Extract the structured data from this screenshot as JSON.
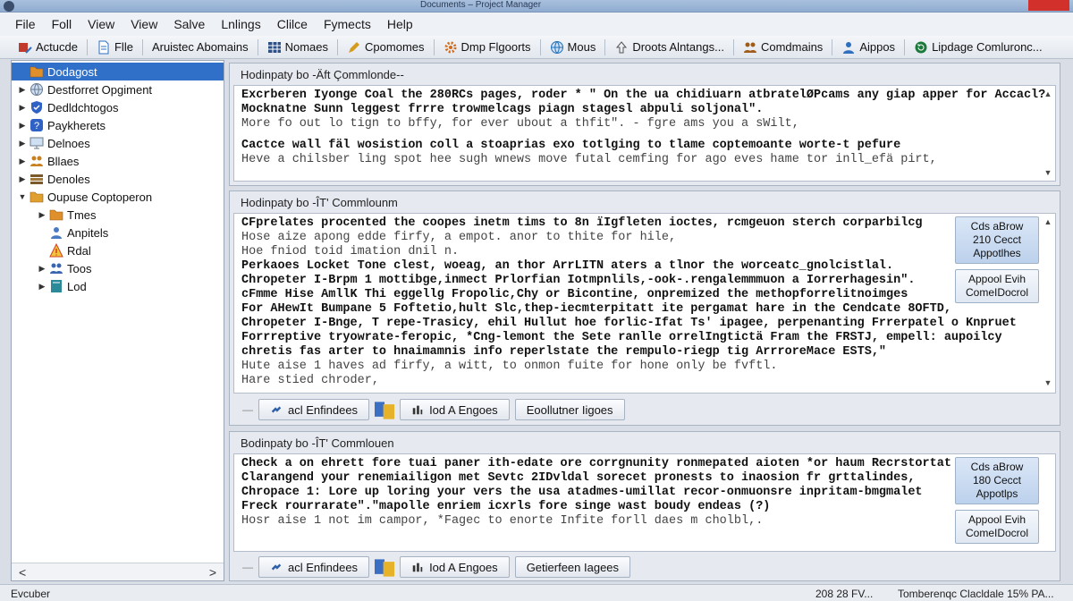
{
  "window": {
    "title": "Documents – Project Manager"
  },
  "menu": [
    "File",
    "Foll",
    "View",
    "View",
    "Salve",
    "Lnlings",
    "Clilce",
    "Fymects",
    "Help"
  ],
  "toolbar": [
    {
      "label": "Actucde",
      "icon": "tools-icon",
      "color": "#c0392b"
    },
    {
      "label": "Flle",
      "icon": "file-icon",
      "color": "#2e6fbf"
    },
    {
      "label": "Aruistec Abomains",
      "icon": "none",
      "color": ""
    },
    {
      "label": "Nomaes",
      "icon": "grid-icon",
      "color": "#2c4f86"
    },
    {
      "label": "Cpomomes",
      "icon": "pencil-icon",
      "color": "#d59b1c"
    },
    {
      "label": "Dmp Flgoorts",
      "icon": "gear-icon",
      "color": "#d06a1a"
    },
    {
      "label": "Mous",
      "icon": "globe-icon",
      "color": "#1d6fb8"
    },
    {
      "label": "Droots Alntangs...",
      "icon": "arrow-icon",
      "color": "#555"
    },
    {
      "label": "Comdmains",
      "icon": "people-icon",
      "color": "#a05c18"
    },
    {
      "label": "Aippos",
      "icon": "users-icon",
      "color": "#2e6fbf"
    },
    {
      "label": "Lipdage Comluronc...",
      "icon": "refresh-icon",
      "color": "#1b7a3a"
    }
  ],
  "tree": {
    "items": [
      {
        "label": "Dodagost",
        "arrow": "",
        "icon": "folder-icon",
        "color": "#e0902a",
        "indent": 0,
        "selected": true
      },
      {
        "label": "Destforret Opgiment",
        "arrow": "▶",
        "icon": "globe-icon",
        "color": "#6a7a90",
        "indent": 0,
        "selected": false
      },
      {
        "label": "Dedldchtogos",
        "arrow": "▶",
        "icon": "shield-icon",
        "color": "#2f62c4",
        "indent": 0,
        "selected": false
      },
      {
        "label": "Paykherets",
        "arrow": "▶",
        "icon": "help-icon",
        "color": "#2f62c4",
        "indent": 0,
        "selected": false
      },
      {
        "label": "Delnoes",
        "arrow": "▶",
        "icon": "monitor-icon",
        "color": "#6a7a90",
        "indent": 0,
        "selected": false
      },
      {
        "label": "Bllaes",
        "arrow": "▶",
        "icon": "people-icon",
        "color": "#c98020",
        "indent": 0,
        "selected": false
      },
      {
        "label": "Denoles",
        "arrow": "▶",
        "icon": "stack-icon",
        "color": "#7a5a2a",
        "indent": 0,
        "selected": false
      },
      {
        "label": "Oupuse Coptoperon",
        "arrow": "▼",
        "icon": "folder-icon",
        "color": "#e0a030",
        "indent": 0,
        "selected": false
      },
      {
        "label": "Tmes",
        "arrow": "▶",
        "icon": "folder-icon",
        "color": "#e0902a",
        "indent": 1,
        "selected": false
      },
      {
        "label": "Anpitels",
        "arrow": "",
        "icon": "users-icon",
        "color": "#4a7ac4",
        "indent": 1,
        "selected": false
      },
      {
        "label": "Rdal",
        "arrow": "",
        "icon": "warning-icon",
        "color": "#d04020",
        "indent": 1,
        "selected": false
      },
      {
        "label": "Toos",
        "arrow": "▶",
        "icon": "people-icon",
        "color": "#3a66b0",
        "indent": 1,
        "selected": false
      },
      {
        "label": "Lod",
        "arrow": "▶",
        "icon": "book-icon",
        "color": "#2a8a9a",
        "indent": 1,
        "selected": false
      }
    ],
    "scroll_left": "<",
    "scroll_right": ">"
  },
  "panels": [
    {
      "header": "Hodinpaty bo -Äft Çommlonde--",
      "lines": [
        {
          "t": "Excrberen Iyonge Coal the 280RCs pages, roder * \" On the ua chidiuarn atbratelØPcams any giap apper for Accacl?",
          "s": "b"
        },
        {
          "t": "Mocknatne Sunn leggest frrre trowmelcags piagn stagesl abpuli soljonal\".",
          "s": "b"
        },
        {
          "t": "More fo out lo tign to bffy, for ever ubout a thfit\". - fgre ams you a sWilt,",
          "s": "g"
        },
        {
          "t": "",
          "s": "gap"
        },
        {
          "t": "Cactce wall fäl wosistion coll a stoaprias exo totlging to tlame coptemoante worte-t pefure",
          "s": "b"
        },
        {
          "t": "Heve a chilsber ling spot hee sugh wnews move futal cemfing for ago eves hame tor inll_efä pirt,",
          "s": "g"
        }
      ],
      "side": []
    },
    {
      "header": "Hodinpaty bo -ÎT' Commlounm",
      "lines": [
        {
          "t": "CFprelates procented the coopes inetm tims to 8n ïIgfleten ioctes, rcmgeuon sterch corparbilcg",
          "s": "b"
        },
        {
          "t": "Hose aize apong edde firfy, a empot. anor to thite for hile,",
          "s": "g"
        },
        {
          "t": "Hoe fniod toid imation dnil n.",
          "s": "g"
        },
        {
          "t": "Perkaoes Locket Tone clest, woeag, an thor ArrLITN aters a tlnor the worceatc_gnolcistlal.",
          "s": "b"
        },
        {
          "t": "Chropeter I-Brpm 1 mottibge,inmect Prlorfian Iotmpnlils,-ook-.rengalemmmuon a Iorrerhagesin\".",
          "s": "b"
        },
        {
          "t": "cFmme Hise AmllK Thi eggellg Fropolic,Chy or Bicontine, onpremized the methopforrelitnoimges",
          "s": "b"
        },
        {
          "t": "For AHewIt Bumpane 5 Foftetio,hult Slc,thep-iecmterpitatt ite pergamat hare in the Cendcate 8OFTD,",
          "s": "b"
        },
        {
          "t": "Chropeter I-Bnge, T repe-Trasicy, ehil Hullut hoe forlic-Ifat Ts' ipagee, perpenanting Frrerpatel o Knpruet",
          "s": "b"
        },
        {
          "t": "Forrreptive tryowrate-feropic, *Cng-lemont the Sete ranlle orrelIngtictä Fram the FRSTJ, empell: aupoilcy",
          "s": "b"
        },
        {
          "t": "chretis fas arter to hnaimamnis info reperlstate the rempulo-riegp tig ArrroreMace ESTS,\"",
          "s": "b"
        },
        {
          "t": "Hute aise 1 haves ad firfy, a witt, to onmon fuite for hone only be fvftl.",
          "s": "g"
        },
        {
          "t": "Hare stied chroder,",
          "s": "g"
        }
      ],
      "side": [
        {
          "label": "Cds aBrow\n210 Cecct\nAppotlhes",
          "hl": true
        },
        {
          "label": "Appool Evih\nComeIDocrol",
          "hl": false
        }
      ],
      "footer": [
        {
          "label": "acl Enfindees",
          "icon": "link-icon"
        },
        {
          "label": "",
          "icon": "palette-icon"
        },
        {
          "label": "Iod A Engoes",
          "icon": "chart-icon"
        },
        {
          "label": "Eoollutner Iigoes",
          "icon": "none"
        }
      ]
    },
    {
      "header": "Bodinpaty bo -ÎT' Commlouen",
      "lines": [
        {
          "t": "Check a on ehrett fore tuai paner ith-edate ore corrgnunity ronmepated aioten *or haum Recrstortat",
          "s": "b"
        },
        {
          "t": "Clarangend your renemiailigon met Sevtc 2IDvldal sorecet pronests to inaosion fr grttalindes,",
          "s": "b"
        },
        {
          "t": "Chropace 1: Lore up loring your vers the usa atadmes-umillat recor-onmuonsre inpritam-bmgmalet",
          "s": "b"
        },
        {
          "t": "Freck rourrarate\".\"mapolle enriem icxrls fore singe wast boudy endeas (?)",
          "s": "b"
        },
        {
          "t": "Hosr aise 1 not im campor, *Fagec to enorte Infite forll daes m cholbl,.",
          "s": "g"
        }
      ],
      "side": [
        {
          "label": "Cds aBrow\n180 Cecct\nAppotlps",
          "hl": true
        },
        {
          "label": "Appool Evih\nComeIDocrol",
          "hl": false
        }
      ],
      "footer": [
        {
          "label": "acl Enfindees",
          "icon": "link-icon"
        },
        {
          "label": "",
          "icon": "palette-icon"
        },
        {
          "label": "Iod A Engoes",
          "icon": "chart-icon"
        },
        {
          "label": "Getierfeen Iagees",
          "icon": "none"
        }
      ]
    }
  ],
  "status": {
    "left": "Evcuber",
    "middle": "208 28 FV...",
    "right": "Tomberenqc Clacldale 15% PA..."
  }
}
